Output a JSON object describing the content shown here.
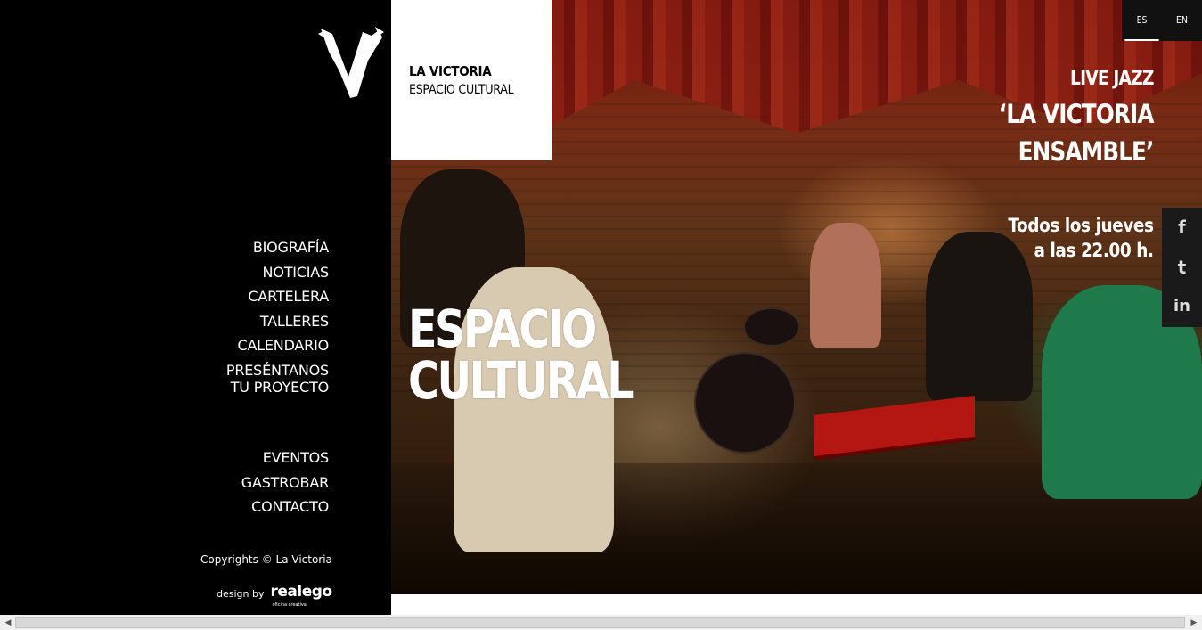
{
  "brand": {
    "title": "LA VICTORIA",
    "subtitle": "ESPACIO CULTURAL"
  },
  "nav": {
    "main": [
      "BIOGRAFÍA",
      "NOTICIAS",
      "CARTELERA",
      "TALLERES",
      "CALENDARIO",
      "PRESÉNTANOS TU PROYECTO"
    ],
    "secondary": [
      "EVENTOS",
      "GASTROBAR",
      "CONTACTO"
    ]
  },
  "footer": {
    "copyright": "Copyrights © La Victoria",
    "design_by": "design by",
    "designer": "realego",
    "designer_tagline": "oficina creativa"
  },
  "hero": {
    "headline_1": "ESPACIO",
    "headline_2": "CULTURAL",
    "event_kicker": "LIVE JAZZ",
    "event_title_1": "‘LA VICTORIA",
    "event_title_2": "ENSAMBLE’",
    "schedule_1": "Todos los jueves",
    "schedule_2": "a las 22.00 h."
  },
  "languages": {
    "es": "ES",
    "en": "EN",
    "active": "ES"
  },
  "social": {
    "facebook": "f",
    "twitter": "t",
    "linkedin": "in"
  }
}
